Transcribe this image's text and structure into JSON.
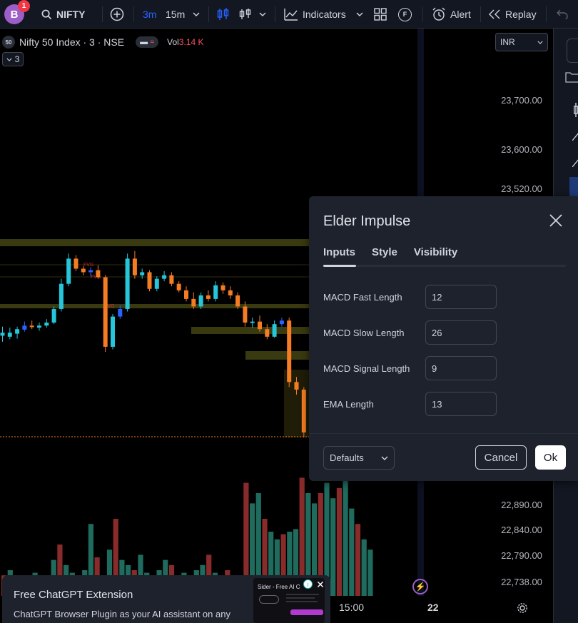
{
  "toolbar": {
    "avatar_letter": "B",
    "notification_count": "1",
    "symbol": "NIFTY",
    "interval_active": "3m",
    "interval_other": "15m",
    "indicators_label": "Indicators",
    "f_label": "F",
    "alert_label": "Alert",
    "replay_label": "Replay"
  },
  "legend": {
    "logo": "50",
    "title": "Nifty 50 Index · 3 · NSE",
    "vol_label": "Vol",
    "vol_value": "3.14 K",
    "collapse_count": "3"
  },
  "currency": "INR",
  "price_axis": {
    "top_labels": [
      "23,700.00",
      "23,600.00",
      "23,520.00"
    ],
    "bottom_labels": [
      "22,890.00",
      "22,840.00",
      "22,790.00",
      "22,738.00"
    ]
  },
  "time_axis": {
    "labels": [
      "15:00",
      "22"
    ]
  },
  "fvg_labels": [
    "FVG",
    "FVG",
    "FVG"
  ],
  "dialog": {
    "title": "Elder Impulse",
    "tabs": [
      "Inputs",
      "Style",
      "Visibility"
    ],
    "active_tab": "Inputs",
    "fields": [
      {
        "label": "MACD Fast Length",
        "value": "12"
      },
      {
        "label": "MACD Slow Length",
        "value": "26"
      },
      {
        "label": "MACD Signal Length",
        "value": "9"
      },
      {
        "label": "EMA Length",
        "value": "13"
      }
    ],
    "defaults_label": "Defaults",
    "cancel_label": "Cancel",
    "ok_label": "Ok"
  },
  "ad": {
    "title": "Free ChatGPT Extension",
    "text": "ChatGPT Browser Plugin as your AI assistant on any",
    "thumb_title": "Sider - Free AI C"
  },
  "colors": {
    "up": "#26c6da",
    "down": "#f57c22",
    "blue_candle": "#2962ff",
    "vol_up": "#1f6b5e",
    "vol_down": "#8a2b2b",
    "fvg_zone": "#3a3a10"
  },
  "chart_data": {
    "type": "candlestick",
    "candles": [
      {
        "o": 23238,
        "h": 23250,
        "l": 23220,
        "c": 23232,
        "dir": "up"
      },
      {
        "o": 23230,
        "h": 23248,
        "l": 23225,
        "c": 23238,
        "dir": "up"
      },
      {
        "o": 23236,
        "h": 23250,
        "l": 23226,
        "c": 23245,
        "dir": "up"
      },
      {
        "o": 23244,
        "h": 23260,
        "l": 23240,
        "c": 23252,
        "dir": "blue"
      },
      {
        "o": 23252,
        "h": 23262,
        "l": 23245,
        "c": 23249,
        "dir": "down"
      },
      {
        "o": 23248,
        "h": 23258,
        "l": 23242,
        "c": 23252,
        "dir": "up"
      },
      {
        "o": 23252,
        "h": 23265,
        "l": 23248,
        "c": 23258,
        "dir": "up"
      },
      {
        "o": 23258,
        "h": 23290,
        "l": 23255,
        "c": 23285,
        "dir": "up"
      },
      {
        "o": 23285,
        "h": 23345,
        "l": 23280,
        "c": 23335,
        "dir": "up"
      },
      {
        "o": 23335,
        "h": 23395,
        "l": 23330,
        "c": 23385,
        "dir": "up"
      },
      {
        "o": 23385,
        "h": 23392,
        "l": 23360,
        "c": 23365,
        "dir": "down"
      },
      {
        "o": 23365,
        "h": 23370,
        "l": 23352,
        "c": 23358,
        "dir": "down"
      },
      {
        "o": 23358,
        "h": 23368,
        "l": 23350,
        "c": 23362,
        "dir": "blue"
      },
      {
        "o": 23362,
        "h": 23372,
        "l": 23345,
        "c": 23348,
        "dir": "down"
      },
      {
        "o": 23348,
        "h": 23352,
        "l": 23200,
        "c": 23210,
        "dir": "down"
      },
      {
        "o": 23210,
        "h": 23275,
        "l": 23205,
        "c": 23270,
        "dir": "up"
      },
      {
        "o": 23270,
        "h": 23292,
        "l": 23265,
        "c": 23285,
        "dir": "blue"
      },
      {
        "o": 23285,
        "h": 23395,
        "l": 23280,
        "c": 23385,
        "dir": "up"
      },
      {
        "o": 23385,
        "h": 23400,
        "l": 23345,
        "c": 23352,
        "dir": "down"
      },
      {
        "o": 23352,
        "h": 23365,
        "l": 23345,
        "c": 23358,
        "dir": "up"
      },
      {
        "o": 23358,
        "h": 23362,
        "l": 23320,
        "c": 23325,
        "dir": "down"
      },
      {
        "o": 23325,
        "h": 23350,
        "l": 23320,
        "c": 23345,
        "dir": "up"
      },
      {
        "o": 23345,
        "h": 23360,
        "l": 23340,
        "c": 23352,
        "dir": "up"
      },
      {
        "o": 23352,
        "h": 23358,
        "l": 23330,
        "c": 23335,
        "dir": "down"
      },
      {
        "o": 23335,
        "h": 23340,
        "l": 23318,
        "c": 23322,
        "dir": "down"
      },
      {
        "o": 23322,
        "h": 23330,
        "l": 23300,
        "c": 23305,
        "dir": "down"
      },
      {
        "o": 23305,
        "h": 23318,
        "l": 23285,
        "c": 23290,
        "dir": "down"
      },
      {
        "o": 23290,
        "h": 23318,
        "l": 23285,
        "c": 23312,
        "dir": "up"
      },
      {
        "o": 23312,
        "h": 23322,
        "l": 23300,
        "c": 23305,
        "dir": "down"
      },
      {
        "o": 23305,
        "h": 23340,
        "l": 23300,
        "c": 23332,
        "dir": "up"
      },
      {
        "o": 23332,
        "h": 23338,
        "l": 23315,
        "c": 23322,
        "dir": "down"
      },
      {
        "o": 23322,
        "h": 23330,
        "l": 23305,
        "c": 23312,
        "dir": "down"
      },
      {
        "o": 23312,
        "h": 23318,
        "l": 23285,
        "c": 23290,
        "dir": "down"
      },
      {
        "o": 23290,
        "h": 23300,
        "l": 23250,
        "c": 23258,
        "dir": "down"
      },
      {
        "o": 23258,
        "h": 23268,
        "l": 23248,
        "c": 23260,
        "dir": "up"
      },
      {
        "o": 23260,
        "h": 23272,
        "l": 23240,
        "c": 23245,
        "dir": "down"
      },
      {
        "o": 23245,
        "h": 23255,
        "l": 23225,
        "c": 23230,
        "dir": "down"
      },
      {
        "o": 23230,
        "h": 23262,
        "l": 23228,
        "c": 23255,
        "dir": "up"
      },
      {
        "o": 23255,
        "h": 23268,
        "l": 23250,
        "c": 23262,
        "dir": "blue"
      },
      {
        "o": 23262,
        "h": 23268,
        "l": 23130,
        "c": 23140,
        "dir": "down"
      },
      {
        "o": 23140,
        "h": 23150,
        "l": 23115,
        "c": 23125,
        "dir": "down"
      },
      {
        "o": 23125,
        "h": 23130,
        "l": 23030,
        "c": 23040,
        "dir": "down"
      }
    ],
    "volumes": [
      8,
      10,
      6,
      7,
      5,
      9,
      6,
      8,
      14,
      20,
      12,
      9,
      7,
      10,
      28,
      15,
      8,
      18,
      30,
      14,
      12,
      10,
      16,
      9,
      8,
      10,
      14,
      12,
      8,
      9,
      7,
      10,
      12,
      16,
      9,
      8,
      10,
      7,
      6,
      44,
      36,
      40,
      30,
      25,
      22,
      24,
      25,
      26,
      46,
      40,
      36,
      40,
      44,
      38,
      42,
      46,
      34,
      28,
      22,
      18
    ]
  }
}
